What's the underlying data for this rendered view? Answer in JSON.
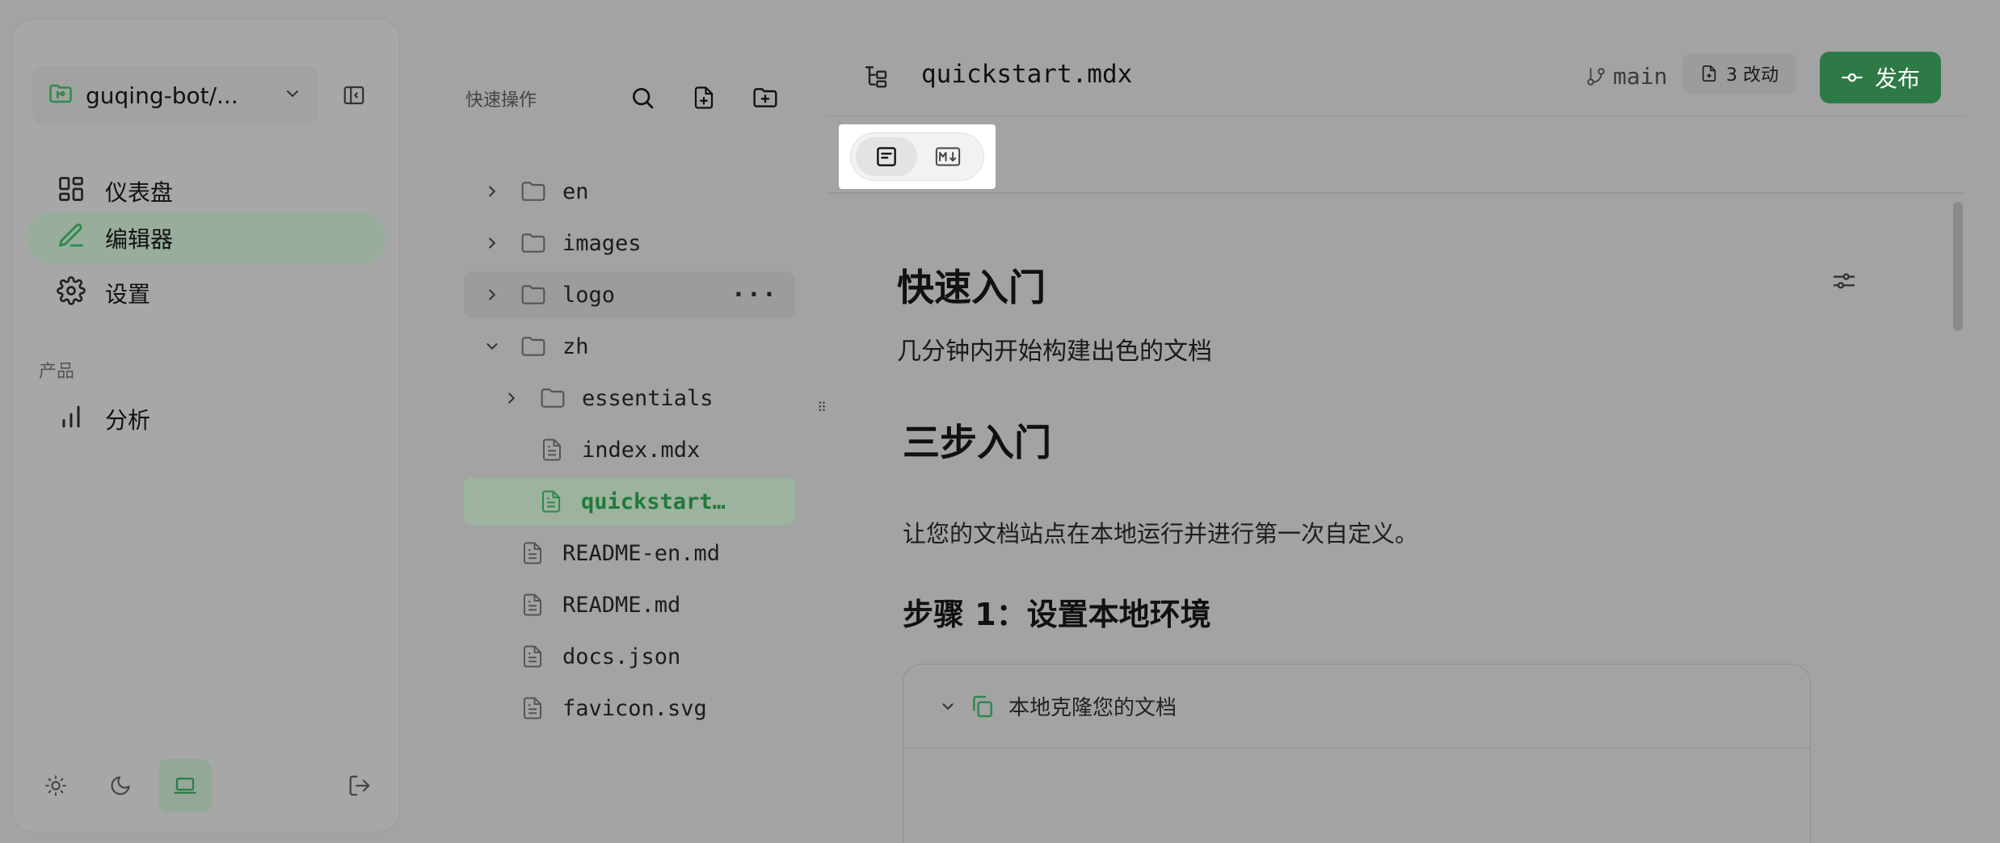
{
  "sidebar": {
    "project_name": "guqing-bot/...",
    "nav": [
      {
        "label": "仪表盘",
        "icon": "dashboard-icon"
      },
      {
        "label": "编辑器",
        "icon": "pen-icon",
        "active": true
      },
      {
        "label": "设置",
        "icon": "gear-icon"
      }
    ],
    "section_label": "产品",
    "product_nav": [
      {
        "label": "分析",
        "icon": "bar-chart-icon"
      }
    ],
    "theme_modes": [
      "light",
      "dark",
      "system"
    ],
    "active_theme": "system"
  },
  "tree": {
    "title": "快速操作",
    "items": [
      {
        "name": "en",
        "type": "folder",
        "expanded": false,
        "depth": 0
      },
      {
        "name": "images",
        "type": "folder",
        "expanded": false,
        "depth": 0
      },
      {
        "name": "logo",
        "type": "folder",
        "expanded": false,
        "depth": 0,
        "hover": true
      },
      {
        "name": "zh",
        "type": "folder",
        "expanded": true,
        "depth": 0
      },
      {
        "name": "essentials",
        "type": "folder",
        "expanded": false,
        "depth": 1
      },
      {
        "name": "index.mdx",
        "type": "file",
        "depth": 1
      },
      {
        "name": "quickstart…",
        "type": "file",
        "depth": 1,
        "selected": true
      },
      {
        "name": "README-en.md",
        "type": "file",
        "depth": 0
      },
      {
        "name": "README.md",
        "type": "file",
        "depth": 0
      },
      {
        "name": "docs.json",
        "type": "file",
        "depth": 0
      },
      {
        "name": "favicon.svg",
        "type": "file",
        "depth": 0
      }
    ]
  },
  "editor": {
    "file_title": "quickstart.mdx",
    "branch": "main",
    "changes_label": "3 改动",
    "publish_label": "发布",
    "accent_color": "#2e7a46",
    "content": {
      "h1": "快速入门",
      "description": "几分钟内开始构建出色的文档",
      "h2": "三步入门",
      "paragraph": "让您的文档站点在本地运行并进行第一次自定义。",
      "h3": "步骤 1：设置本地环境",
      "accordion_title": "本地克隆您的文档"
    }
  }
}
